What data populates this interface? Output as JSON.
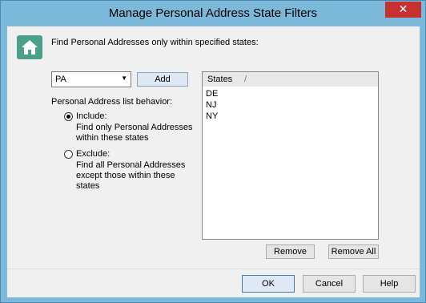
{
  "window": {
    "title": "Manage Personal Address State Filters",
    "close_symbol": "✕"
  },
  "heading": "Find Personal Addresses only within specified states:",
  "state_select": {
    "value": "PA"
  },
  "add_label": "Add",
  "behavior_label": "Personal Address list behavior:",
  "include": {
    "title": "Include:",
    "lines": [
      "Find only Personal Addresses",
      "within these states"
    ],
    "selected": true
  },
  "exclude": {
    "title": "Exclude:",
    "lines": [
      "Find all Personal Addresses",
      "except those within these",
      "states"
    ],
    "selected": false
  },
  "states_list": {
    "header": "States",
    "sort_mark": "/",
    "items": [
      "DE",
      "NJ",
      "NY"
    ]
  },
  "remove_label": "Remove",
  "remove_all_label": "Remove All",
  "footer": {
    "ok": "OK",
    "cancel": "Cancel",
    "help": "Help"
  },
  "colors": {
    "frame": "#7bb8d9",
    "close": "#c7312f",
    "icon": "#4aa08a"
  }
}
